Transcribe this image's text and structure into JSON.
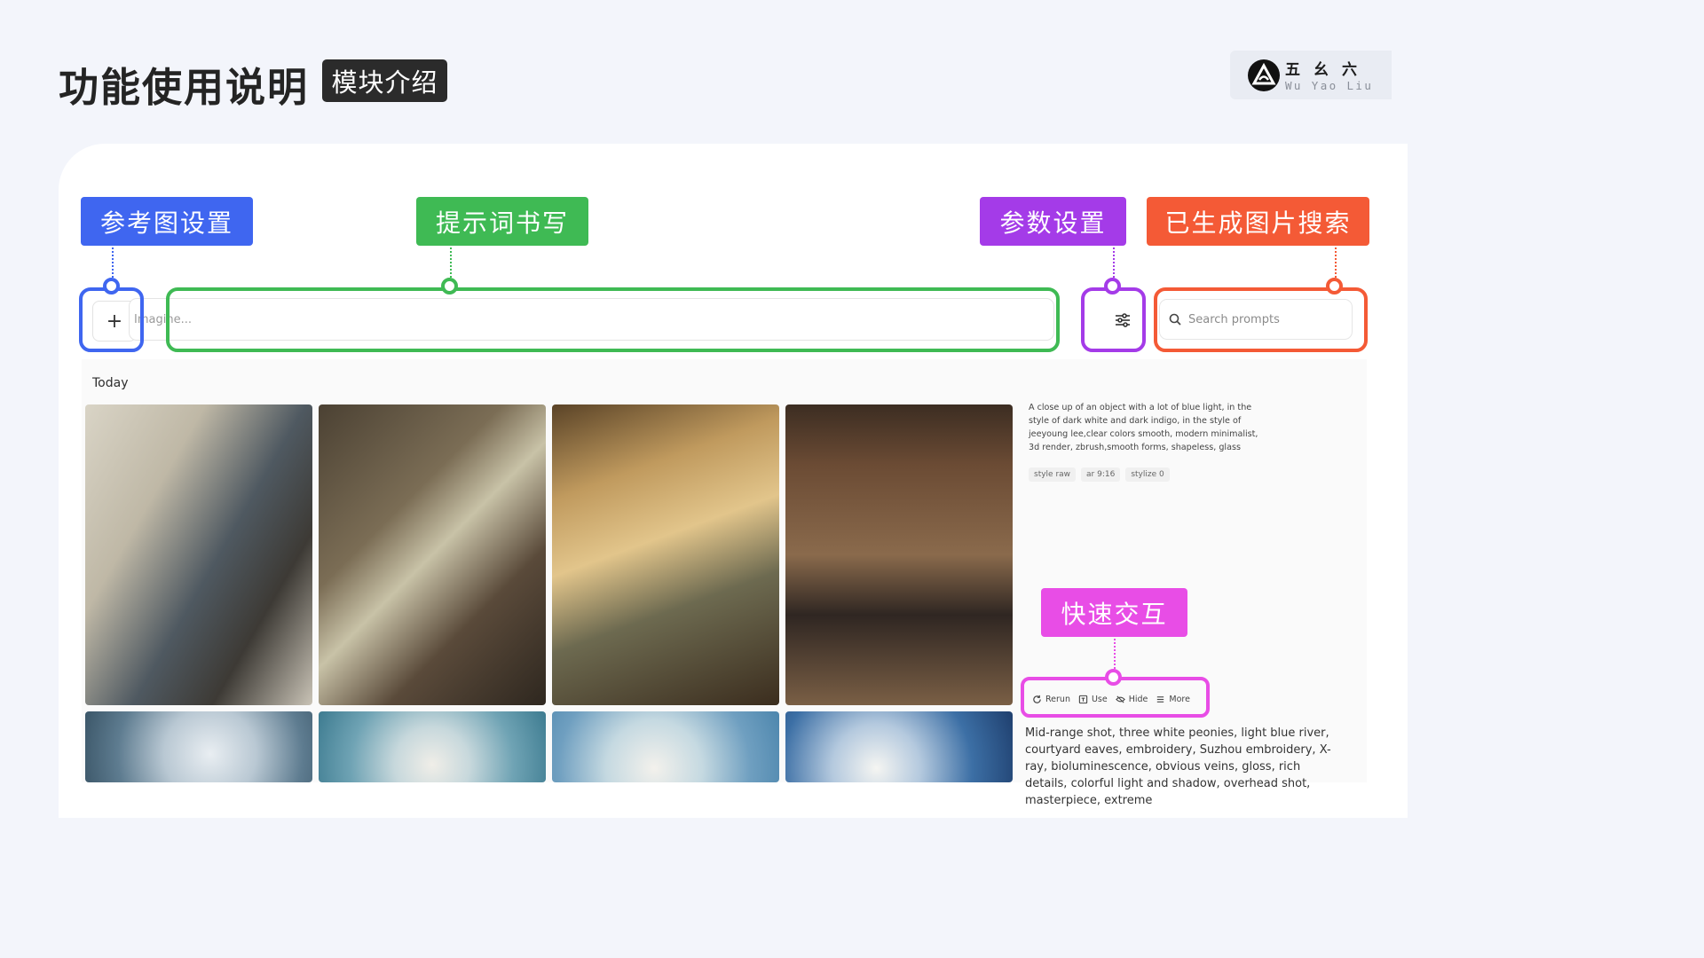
{
  "header": {
    "title": "功能使用说明",
    "badge": "模块介绍",
    "brand_cn": "五幺六",
    "brand_en": "Wu Yao Liu"
  },
  "annotations": {
    "reference_image": "参考图设置",
    "prompt_writing": "提示词书写",
    "parameter_settings": "参数设置",
    "search_generated": "已生成图片搜索",
    "quick_interaction": "快速交互"
  },
  "toolbar": {
    "add_label": "+",
    "prompt_placeholder": "Imagine...",
    "search_placeholder": "Search prompts"
  },
  "feed": {
    "section": "Today",
    "prompt_1": "A close up of an object with a lot of blue light, in the style of dark white and dark indigo, in the style of jeeyoung lee,clear colors smooth, modern minimalist, 3d render, zbrush,smooth forms, shapeless, glass",
    "tags": [
      "style raw",
      "ar 9:16",
      "stylize 0"
    ],
    "actions": [
      "Rerun",
      "Use",
      "Hide",
      "More"
    ],
    "prompt_2": "Mid-range shot, three white peonies, light blue river, courtyard eaves, embroidery, Suzhou embroidery, X-ray, bioluminescence, obvious veins, gloss, rich details, colorful light and shadow, overhead shot, masterpiece, extreme"
  },
  "colors": {
    "blue": "#3f66f0",
    "green": "#3fba54",
    "purple": "#a43be8",
    "orange": "#f45a36",
    "pink": "#e84de6"
  }
}
